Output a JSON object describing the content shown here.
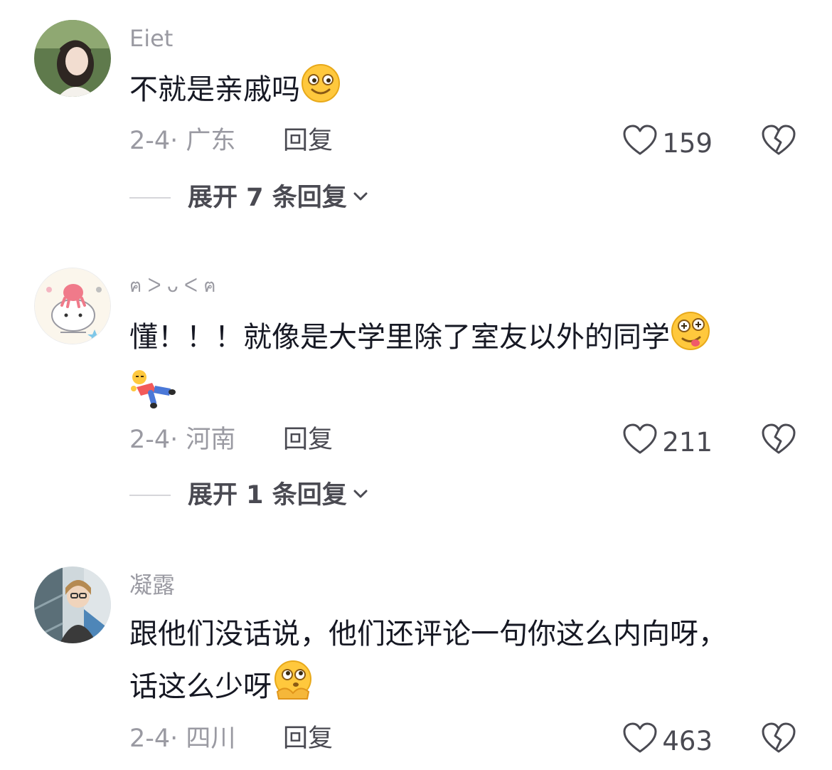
{
  "comments": [
    {
      "username": "Eiet",
      "text": "不就是亲戚吗",
      "emoji": "smile-emoji",
      "date_location": "2-4· 广东",
      "reply_label": "回复",
      "likes": "159",
      "expand_label": "展开 7 条回复"
    },
    {
      "username": "ฅ ᐳ ᴗ ᐸ ฅ",
      "text": "懂！！！就像是大学里除了室友以外的同学",
      "emoji": "crazy-face-emoji",
      "emoji2": "lying-person-emoji",
      "date_location": "2-4· 河南",
      "reply_label": "回复",
      "likes": "211",
      "expand_label": "展开 1 条回复"
    },
    {
      "username": "凝露",
      "text_line1": "跟他们没话说，他们还评论一句你这么内向呀，",
      "text_line2": "话这么少呀",
      "emoji": "thinking-shy-emoji",
      "date_location": "2-4· 四川",
      "reply_label": "回复",
      "likes": "463"
    }
  ],
  "icons": {
    "like": "heart-outline-icon",
    "dislike": "broken-heart-icon",
    "expand": "chevron-down-icon"
  },
  "colors": {
    "text_primary": "#161823",
    "text_secondary": "#9a9aa2",
    "emoji_yellow": "#ffc83d"
  }
}
